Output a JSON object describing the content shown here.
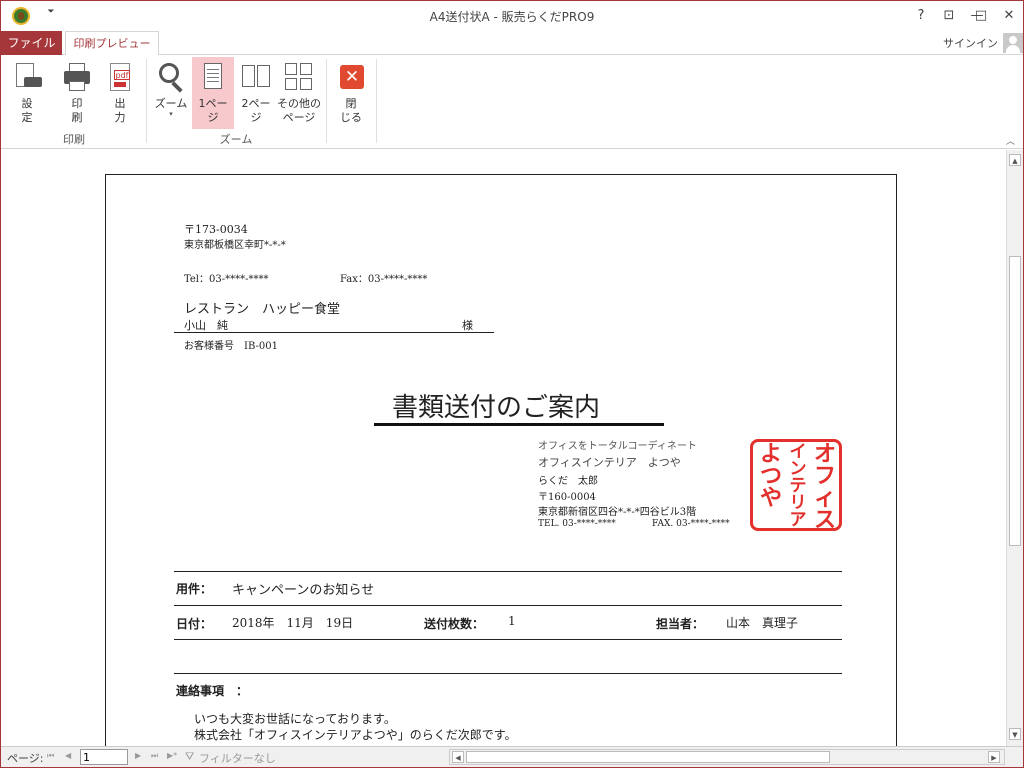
{
  "window": {
    "title": "A4送付状A - 販売らくだPRO9",
    "help": "?",
    "restore_ribbon": "⊡",
    "minimize": "—",
    "maximize": "□",
    "close": "✕",
    "qat_menu": "⏷"
  },
  "tabs": {
    "file": "ファイル",
    "print_preview": "印刷プレビュー",
    "signin": "サインイン"
  },
  "ribbon": {
    "print_group": {
      "label": "印刷",
      "setup": "設定",
      "setup_line1": "設",
      "setup_line2": "定",
      "print_line1": "印",
      "print_line2": "刷",
      "output_line1": "出",
      "output_line2": "力",
      "pdf_tag": "pdf"
    },
    "zoom_group": {
      "label": "ズーム",
      "zoom": "ズーム",
      "page1_line1": "1ページ",
      "page1_line1_short": "1ペー",
      "page1_line2": "ジ",
      "page2_line1": "2ペー",
      "page2_line2": "ジ",
      "other_line1": "その他の",
      "other_line2": "ページ"
    },
    "close_group": {
      "close_line1": "閉",
      "close_line2": "じる",
      "close_glyph": "✕"
    }
  },
  "document": {
    "sender_postal": "〒173-0034",
    "sender_address": "東京都板橋区幸町*-*-*",
    "tel": "Tel：03-****-****",
    "fax": "Fax：03-****-****",
    "recipient_company": "レストラン　ハッピー食堂",
    "recipient_name": "小山　純",
    "honorific": "様",
    "customer_no": "お客様番号　IB-001",
    "doc_title": "書類送付のご案内",
    "company_tagline": "オフィスをトータルコーディネート",
    "company_name": "オフィスインテリア　よつや",
    "person": "らくだ　太郎",
    "company_postal": "〒160-0004",
    "company_address": "東京都新宿区四谷*-*-*四谷ビル3階",
    "company_tel": "TEL. 03-****-****",
    "company_fax": "FAX. 03-****-****",
    "stamp_col1": "オフィス",
    "stamp_col2": "インテリア",
    "stamp_col3": "よつや",
    "subject_label": "用件：",
    "subject_value": "キャンペーンのお知らせ",
    "date_label": "日付：",
    "date_value": "2018年　11月　19日",
    "pages_label": "送付枚数：",
    "pages_value": "1",
    "staff_label": "担当者：",
    "staff_value": "山本　真理子",
    "notes_label": "連絡事項　：",
    "notes_line1": "いつも大変お世話になっております。",
    "notes_line2": "株式会社「オフィスインテリアよつや」のらくだ次郎です。"
  },
  "statusbar": {
    "page_label": "ページ:",
    "first": "⏮",
    "prev": "◀",
    "next": "▶",
    "last": "⏭",
    "new": "▶*",
    "page_value": "1",
    "filter": "フィルターなし",
    "filter_icon": "⛛"
  },
  "scroll": {
    "up": "▲",
    "down": "▼",
    "left": "◀",
    "right": "▶"
  },
  "colors": {
    "accent": "#a5373a",
    "selected": "#f7c9cc",
    "stamp": "#e3302c"
  }
}
